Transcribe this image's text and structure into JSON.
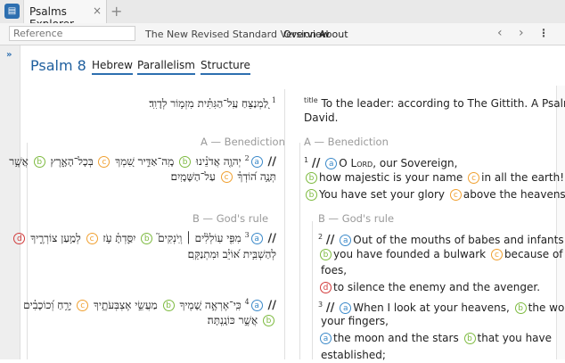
{
  "tab": {
    "title": "Psalms Explorer",
    "close_icon": "×",
    "add_icon": "+"
  },
  "toolbar": {
    "reference_placeholder": "Reference",
    "version": "The New Revised Standard Version",
    "version_caret": "▾",
    "overview": "Overview",
    "about": "About",
    "back_icon": "‹",
    "forward_icon": "›",
    "more_icon": "⋮"
  },
  "sidebar": {
    "expand_icon": "»"
  },
  "header": {
    "title": "Psalm 8",
    "tabs": [
      "Hebrew",
      "Parallelism",
      "Structure"
    ]
  },
  "headings": {
    "benediction": "A — Benediction",
    "gods_rule": "B — God's rule"
  },
  "markers": {
    "a": "a",
    "b": "b",
    "c": "c",
    "d": "d",
    "slash": "//"
  },
  "hebrew": {
    "v1": {
      "num": "1",
      "line1": "לַ֭מְנַצֵּחַ עַֽל־הַגִּתִּ֗ית מִזְמ֥וֹר לְדָוִֽד׃"
    },
    "v2": {
      "num": "2",
      "a": "יְהוָ֤ה אֲדֹנֵ֗ינוּ",
      "b": "מָֽה־אַדִּ֣יר שִׁ֭מְךָ",
      "c": "בְּכָל־הָאָ֑רֶץ",
      "d": "אֲשֶׁ֥ר",
      "line2a": "תְּנָ֥ה ה֝וֹדְךָ֗",
      "line2b": "עַל־הַשָּׁמָֽיִם׃"
    },
    "v3": {
      "num": "3",
      "a": "מִפִּ֤י עֽוֹלְלִ֨ים ׀ וְֽיֹנְקִים֮",
      "b": "יִסַּ֪דְתָּ֫ עֹ֥ז",
      "c": "לְמַ֥עַן צוֹרְרֶ֑יךָ",
      "line2": "לְהַשְׁבִּ֥ית א֝וֹיֵ֗ב וּמִתְנַקֵּֽם׃"
    },
    "v4": {
      "num": "4",
      "a": "כִּֽי־אֶרְאֶ֣ה שָׁ֭מֶיךָ",
      "b": "מַעֲשֵׂ֣י אֶצְבְּעֹתֶ֑יךָ",
      "c": "יָרֵ֥חַ וְ֝כוֹכָבִ֗ים",
      "line2": "אֲשֶׁ֣ר כּוֹנָֽנְתָּה׃"
    }
  },
  "english": {
    "v1": {
      "num": "1",
      "prefix": "title",
      "line1": "To the leader: according to The Gittith. A Psalm of",
      "line2": "David."
    },
    "v2": {
      "num": "1",
      "line1_pre": "O ",
      "line1_lord": "Lord",
      "line1_post": ", our Sovereign,",
      "line2_b": "how majestic is your name",
      "line2_c": "in all the earth!",
      "line3_b": "You have set your glory",
      "line3_c": "above the heavens."
    },
    "v3": {
      "num": "2",
      "line1_a": "Out of the mouths of babes and infants",
      "line2_b": "you have founded a bulwark",
      "line2_c": "because of your",
      "line3": "foes,",
      "line4_d": "to silence the enemy and the avenger."
    },
    "v4": {
      "num": "3",
      "line1_a": "When I look at your heavens,",
      "line1_b": "the work of",
      "line2": "your fingers,",
      "line3_a": "the moon and the stars",
      "line3_b": "that you have",
      "line4": "established;"
    }
  }
}
